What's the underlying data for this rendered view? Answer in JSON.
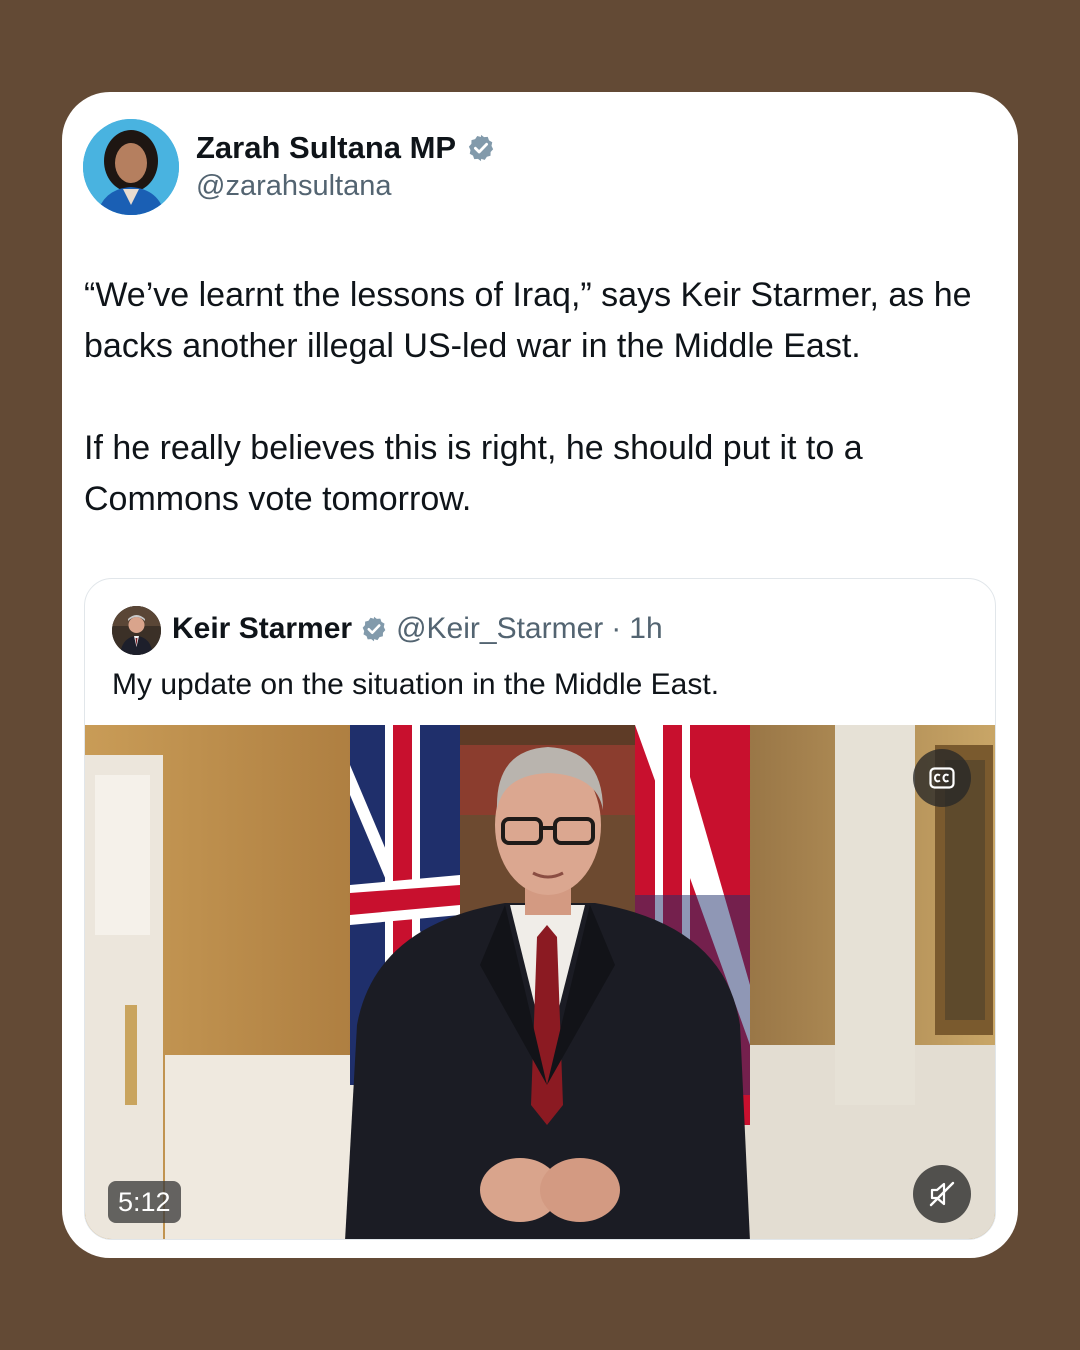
{
  "post": {
    "author_name": "Zarah Sultana MP",
    "author_handle": "@zarahsultana",
    "paragraph_1": "“We’ve learnt the lessons of Iraq,” says Keir Starmer, as he backs another illegal US-led war in the Middle East.",
    "paragraph_2": "If he really believes this is right, he should put it to a Commons vote tomorrow."
  },
  "quoted_post": {
    "author_name": "Keir Starmer",
    "author_handle": "@Keir_Starmer",
    "separator": "·",
    "time": "1h",
    "text": "My update on the situation in the Middle East.",
    "video": {
      "duration": "5:12",
      "captions_icon": "closed-captions-icon",
      "mute_icon": "muted-speaker-icon"
    }
  },
  "colors": {
    "background": "#634a35",
    "card": "#ffffff",
    "verified_badge": "#829aab",
    "text_primary": "#0f1419",
    "text_secondary": "#536471"
  }
}
